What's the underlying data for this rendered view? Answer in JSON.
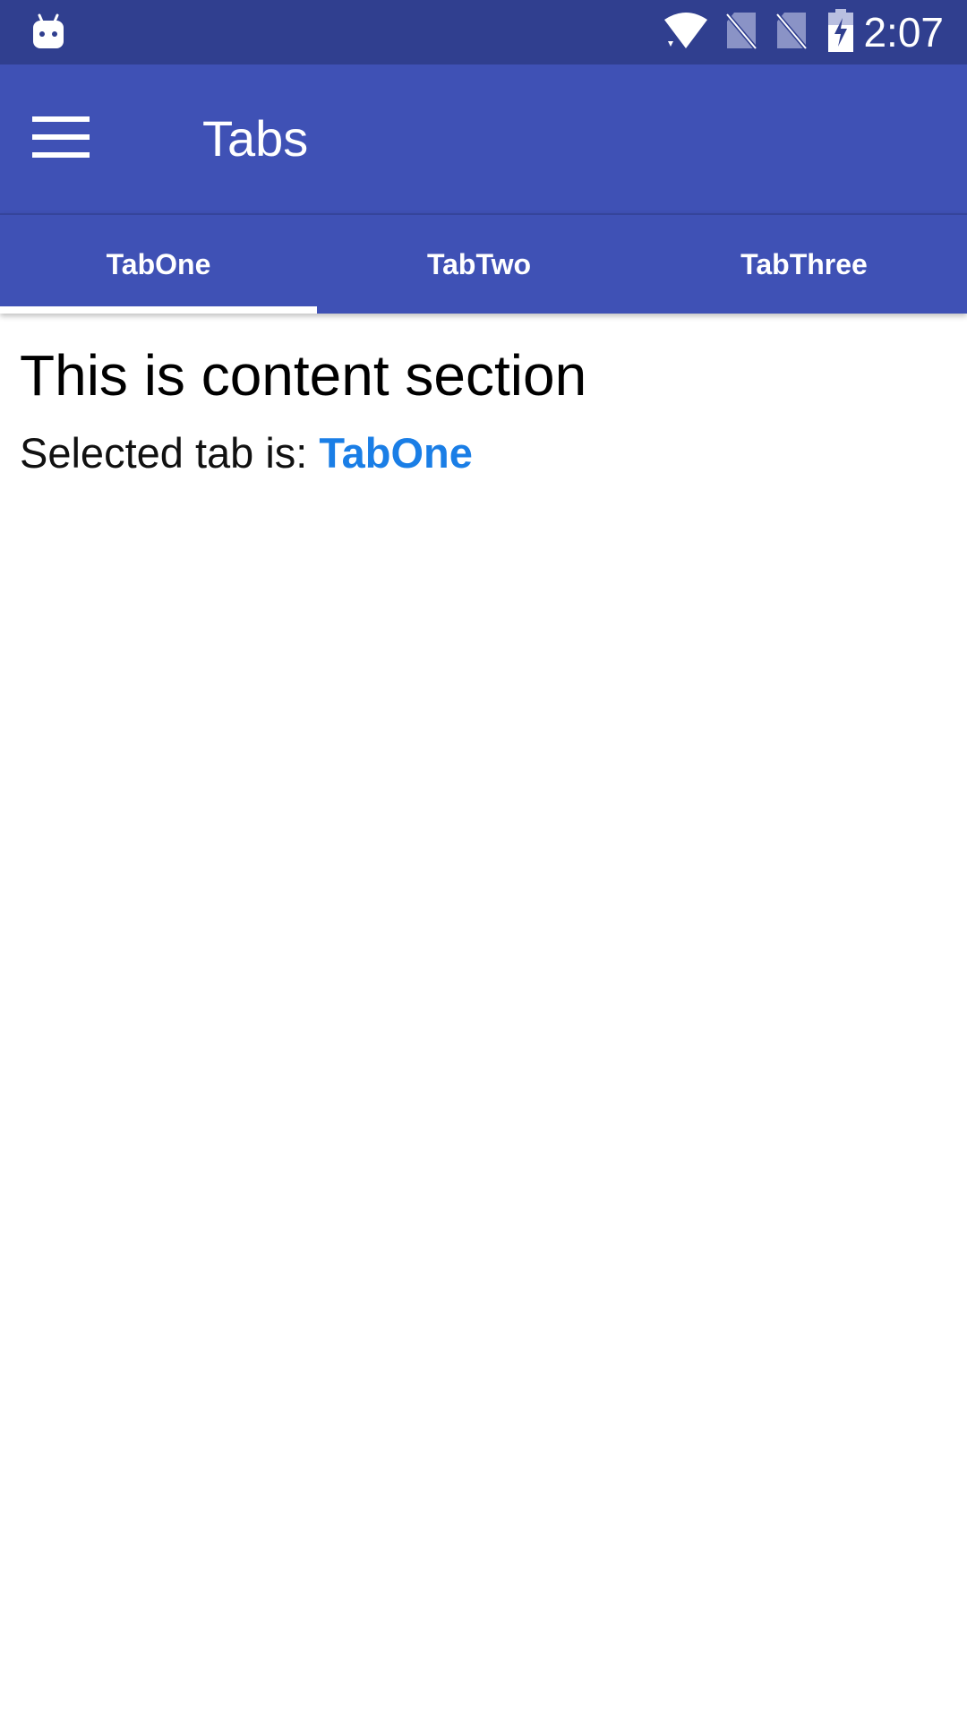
{
  "status_bar": {
    "time": "2:07",
    "colors": {
      "background": "#303f8f"
    },
    "icons": [
      "android-app-icon",
      "wifi-icon",
      "no-sim-icon",
      "no-sim-icon",
      "battery-charging-icon"
    ]
  },
  "app_bar": {
    "title": "Tabs",
    "menu_icon": "hamburger-menu-icon",
    "colors": {
      "background": "#3f51b5",
      "text": "#ffffff"
    }
  },
  "tabs": {
    "items": [
      {
        "label": "TabOne",
        "selected": true
      },
      {
        "label": "TabTwo",
        "selected": false
      },
      {
        "label": "TabThree",
        "selected": false
      }
    ],
    "colors": {
      "indicator": "#ffffff"
    }
  },
  "content": {
    "title": "This is content section",
    "selected_prefix": "Selected tab is:",
    "selected_value": "TabOne",
    "colors": {
      "selected_value": "#1a7ee6"
    }
  }
}
